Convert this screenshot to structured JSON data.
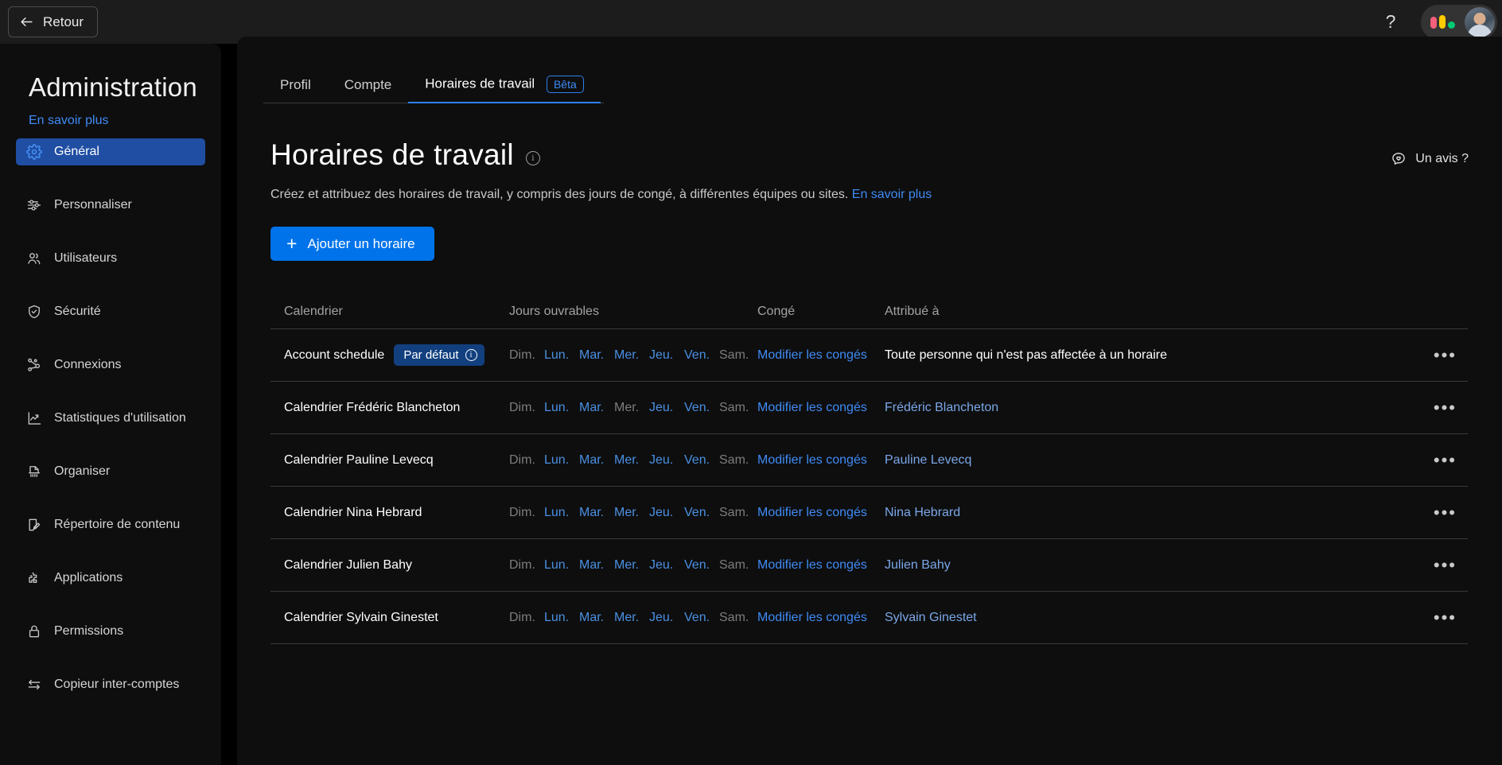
{
  "topbar": {
    "back_label": "Retour",
    "help_icon": "question-mark-icon",
    "logo": "monday-logo"
  },
  "sidebar": {
    "title": "Administration",
    "learn_more": "En savoir plus",
    "items": [
      {
        "label": "Général",
        "icon": "gear-icon",
        "active": true
      },
      {
        "label": "Personnaliser",
        "icon": "sliders-icon",
        "active": false
      },
      {
        "label": "Utilisateurs",
        "icon": "users-icon",
        "active": false
      },
      {
        "label": "Sécurité",
        "icon": "shield-check-icon",
        "active": false
      },
      {
        "label": "Connexions",
        "icon": "nodes-icon",
        "active": false
      },
      {
        "label": "Statistiques d'utilisation",
        "icon": "chart-line-icon",
        "active": false
      },
      {
        "label": "Organiser",
        "icon": "shredder-icon",
        "active": false
      },
      {
        "label": "Répertoire de contenu",
        "icon": "edit-doc-icon",
        "active": false
      },
      {
        "label": "Applications",
        "icon": "puzzle-icon",
        "active": false
      },
      {
        "label": "Permissions",
        "icon": "lock-icon",
        "active": false
      },
      {
        "label": "Copieur inter-comptes",
        "icon": "transfer-arrows-icon",
        "active": false
      }
    ]
  },
  "tabs": [
    {
      "label": "Profil",
      "active": false,
      "badge": ""
    },
    {
      "label": "Compte",
      "active": false,
      "badge": ""
    },
    {
      "label": "Horaires de travail",
      "active": true,
      "badge": "Bêta"
    }
  ],
  "page": {
    "title": "Horaires de travail",
    "info_icon": "info-icon",
    "feedback_label": "Un avis ?",
    "feedback_icon": "feedback-heart-icon",
    "subtitle": "Créez et attribuez des horaires de travail, y compris des jours de congé, à différentes équipes ou sites.",
    "subtitle_link": "En savoir plus",
    "add_button": "Ajouter un horaire"
  },
  "table": {
    "headers": {
      "calendar": "Calendrier",
      "workdays": "Jours ouvrables",
      "leave": "Congé",
      "assigned": "Attribué à"
    },
    "day_labels": [
      "Dim.",
      "Lun.",
      "Mar.",
      "Mer.",
      "Jeu.",
      "Ven.",
      "Sam."
    ],
    "leave_link_label": "Modifier les congés",
    "default_badge": "Par défaut",
    "more_icon": "more-horizontal-icon",
    "rows": [
      {
        "name": "Account schedule",
        "badge": "Par défaut",
        "days": [
          false,
          true,
          true,
          true,
          true,
          true,
          false
        ],
        "leave": "Modifier les congés",
        "assigned": "Toute personne qui n'est pas affectée à un horaire",
        "assigned_is_link": false
      },
      {
        "name": "Calendrier Frédéric Blancheton",
        "badge": "",
        "days": [
          false,
          true,
          true,
          false,
          true,
          true,
          false
        ],
        "leave": "Modifier les congés",
        "assigned": "Frédéric Blancheton",
        "assigned_is_link": true
      },
      {
        "name": "Calendrier Pauline Levecq",
        "badge": "",
        "days": [
          false,
          true,
          true,
          true,
          true,
          true,
          false
        ],
        "leave": "Modifier les congés",
        "assigned": "Pauline Levecq",
        "assigned_is_link": true
      },
      {
        "name": "Calendrier Nina Hebrard",
        "badge": "",
        "days": [
          false,
          true,
          true,
          true,
          true,
          true,
          false
        ],
        "leave": "Modifier les congés",
        "assigned": "Nina Hebrard",
        "assigned_is_link": true
      },
      {
        "name": "Calendrier Julien Bahy",
        "badge": "",
        "days": [
          false,
          true,
          true,
          true,
          true,
          true,
          false
        ],
        "leave": "Modifier les congés",
        "assigned": "Julien Bahy",
        "assigned_is_link": true
      },
      {
        "name": "Calendrier Sylvain Ginestet",
        "badge": "",
        "days": [
          false,
          true,
          true,
          true,
          true,
          true,
          false
        ],
        "leave": "Modifier les congés",
        "assigned": "Sylvain Ginestet",
        "assigned_is_link": true
      }
    ]
  },
  "colors": {
    "accent": "#0073ea",
    "link": "#3f8bf5",
    "active_nav": "#1f4ea3",
    "day_on": "#4a90e2",
    "day_off": "#7d7d7d"
  }
}
